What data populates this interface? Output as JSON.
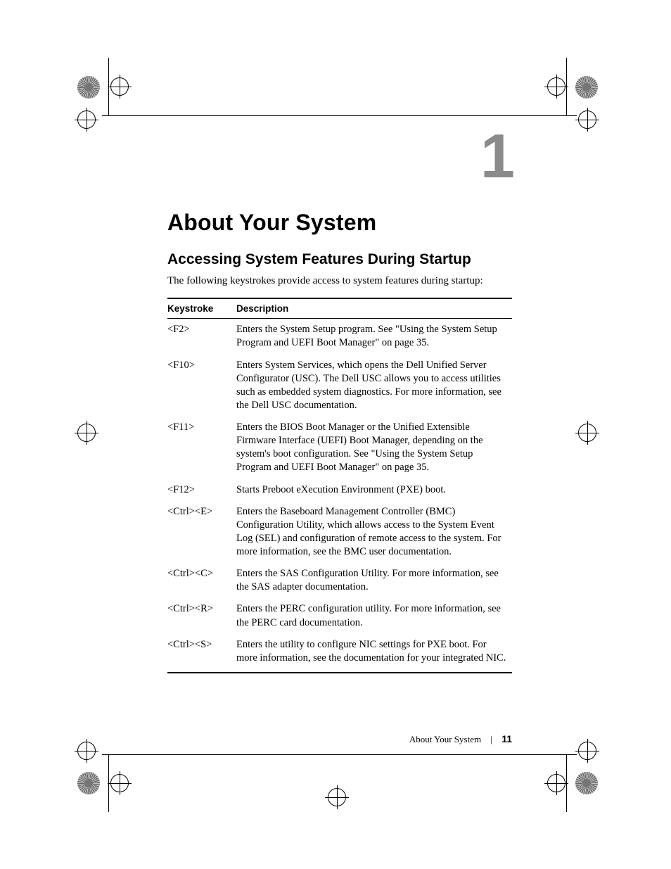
{
  "chapter_number": "1",
  "title": "About Your System",
  "subtitle": "Accessing System Features During Startup",
  "intro": "The following keystrokes provide access to system features during startup:",
  "table": {
    "headers": {
      "keystroke": "Keystroke",
      "description": "Description"
    },
    "rows": [
      {
        "key": "<F2>",
        "desc": "Enters the System Setup program. See \"Using the System Setup Program and UEFI Boot Manager\" on page 35."
      },
      {
        "key": "<F10>",
        "desc": "Enters System Services, which opens the Dell Unified Server Configurator (USC). The Dell USC allows you to access utilities such as embedded system diagnostics. For more information, see the Dell USC documentation."
      },
      {
        "key": "<F11>",
        "desc": "Enters the BIOS Boot Manager or the Unified Extensible Firmware Interface (UEFI) Boot Manager, depending on the system's boot configuration. See \"Using the System Setup Program and UEFI Boot Manager\" on page 35."
      },
      {
        "key": "<F12>",
        "desc": "Starts Preboot eXecution Environment (PXE) boot."
      },
      {
        "key": "<Ctrl><E>",
        "desc": "Enters the Baseboard Management Controller (BMC) Configuration Utility, which allows access to the System Event Log (SEL) and configuration of remote access to the system. For more information, see the BMC user documentation."
      },
      {
        "key": "<Ctrl><C>",
        "desc": "Enters the SAS Configuration Utility. For more information, see the SAS adapter documentation."
      },
      {
        "key": "<Ctrl><R>",
        "desc": "Enters the PERC configuration utility. For more information, see the PERC card documentation."
      },
      {
        "key": "<Ctrl><S>",
        "desc": "Enters the utility to configure NIC settings for PXE boot. For more information, see the documentation for your integrated NIC."
      }
    ]
  },
  "footer": {
    "section": "About Your System",
    "page": "11"
  }
}
